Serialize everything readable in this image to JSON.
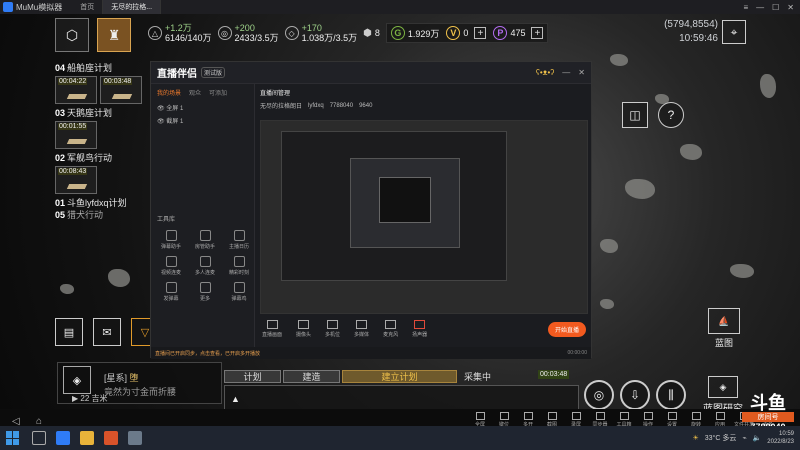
{
  "emulator": {
    "title": "MuMu模拟器",
    "tabs": [
      {
        "label": "首页"
      },
      {
        "label": "无尽的拉格..."
      }
    ],
    "toolbar": [
      "全屏",
      "键位",
      "多开",
      "截图",
      "录屏",
      "同步器",
      "工具箱",
      "操作",
      "设置",
      "旋转",
      "应用",
      "文件共享",
      "更多"
    ]
  },
  "game": {
    "resources": [
      {
        "icon": "△",
        "delta": "+1.2万",
        "value": "6146/140万"
      },
      {
        "icon": "◎",
        "delta": "+200",
        "value": "2433/3.5万"
      },
      {
        "icon": "◇",
        "delta": "+170",
        "value": "1.038万/3.5万"
      }
    ],
    "energy": "8",
    "currencies": [
      {
        "value": "1.929万",
        "color": "#7cb342"
      },
      {
        "value": "0",
        "color": "#f0c14a"
      },
      {
        "value": "475",
        "color": "#b36cf0"
      }
    ],
    "coordinates": "(5794,8554)",
    "clock": "10:59:46",
    "plans": [
      {
        "num": "04",
        "name": "船舶座计划",
        "timers": [
          "00:04:22",
          "00:03:48"
        ]
      },
      {
        "num": "03",
        "name": "天鹅座计划",
        "timers": [
          "00:01:55"
        ]
      },
      {
        "num": "02",
        "name": "军舰鸟行动",
        "timers": [
          "00:08:43"
        ]
      },
      {
        "num": "01",
        "name": "斗鱼lyfdxq计划",
        "timers": []
      },
      {
        "num": "05",
        "name": "猎犬行动",
        "timers": []
      }
    ],
    "blueprint_label": "蓝图",
    "research_label": "蓝图研究",
    "chat": {
      "channel": "[星系]",
      "name": "堕",
      "message": "竟然为寸金而折腰",
      "level": "22",
      "level_unit": "吉米"
    },
    "action_tabs": [
      "计划",
      "建造",
      "建立计划",
      "采集中"
    ],
    "action_timer": "00:03:48"
  },
  "streamer": {
    "app_name": "直播伴侣",
    "badge": "测试版",
    "side_tabs": [
      "我的场景",
      "观众",
      "可添加"
    ],
    "scenes": [
      "全屏 1",
      "截屏 1"
    ],
    "tools_title": "工具库",
    "tools": [
      "弹幕助手",
      "房管助手",
      "主播日历",
      "视频连麦",
      "多人连麦",
      "精彩时刻",
      "发弹幕",
      "更多",
      "弹幕鸡"
    ],
    "room_title": "直播间管理",
    "room_labels": [
      "无尽的拉格朗日",
      "lyfdxq",
      "7788040",
      "9640"
    ],
    "bottom_actions": [
      "直播画面",
      "摄像头",
      "多机位",
      "多媒体",
      "麦克风",
      "扬声器"
    ],
    "live_button": "开始直播",
    "status_text": "直播间已开启同步，点击查看，已开启多开播放",
    "status_time": "00:00:00"
  },
  "douyu": {
    "logo": "斗鱼",
    "room_label": "房间号",
    "room_id": "7788040"
  },
  "taskbar": {
    "weather": "33°C 多云",
    "time": "10:59",
    "date": "2022/8/23"
  }
}
